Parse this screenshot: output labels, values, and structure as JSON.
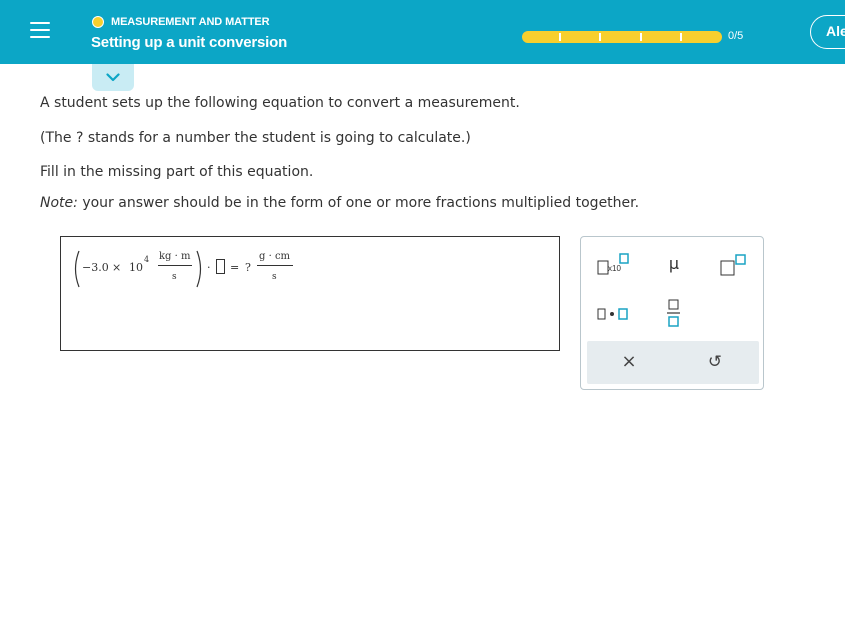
{
  "header": {
    "topic": "MEASUREMENT AND MATTER",
    "title": "Setting up a unit conversion",
    "progress_text": "0/5",
    "progress_fraction": 0,
    "account_button": "Ale",
    "colors": {
      "header_bg": "#0ca6c6",
      "progress": "#f7cf2e",
      "topic_dot": "#f7cf2e"
    }
  },
  "prompt": {
    "line1": "A student sets up the following equation to convert a measurement.",
    "line2": "(The ? stands for a number the student is going to calculate.)",
    "line3": "Fill in the missing part of this equation.",
    "note_label": "Note:",
    "note_text": "your answer should be in the form of one or more fractions multiplied together."
  },
  "equation": {
    "coefficient": "−3.0",
    "times": "×",
    "base": "10",
    "exponent": "4",
    "lhs_num": "kg · m",
    "lhs_den": "s",
    "dot": "·",
    "equals": "=",
    "unknown": "?",
    "rhs_num": "g · cm",
    "rhs_den": "s"
  },
  "keypad": {
    "sci_label": "x10",
    "mu": "μ",
    "clear_label": "×",
    "undo_label": "↺"
  }
}
